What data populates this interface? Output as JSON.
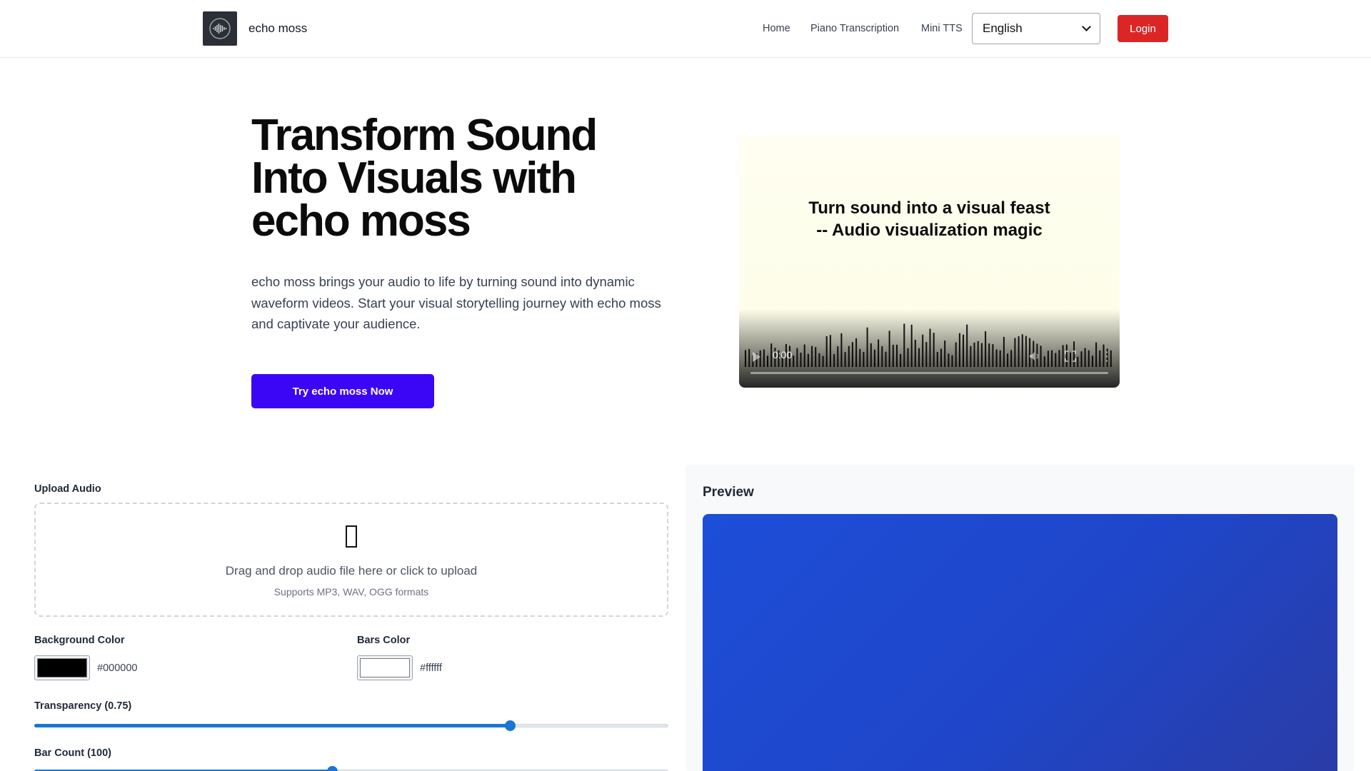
{
  "header": {
    "brand": "echo moss",
    "nav": [
      "Home",
      "Piano Transcription",
      "Mini TTS"
    ],
    "language": "English",
    "login_label": "Login"
  },
  "hero": {
    "title": "Transform Sound Into Visuals with echo moss",
    "description": "echo moss brings your audio to life by turning sound into dynamic waveform videos. Start your visual storytelling journey with echo moss and captivate your audience.",
    "cta_label": "Try echo moss Now"
  },
  "video": {
    "caption_line1": "Turn sound into a visual feast",
    "caption_line2": "-- Audio visualization magic",
    "time": "0:00"
  },
  "upload": {
    "label": "Upload Audio",
    "icon": "file-icon",
    "drop_text": "Drag and drop audio file here or click to upload",
    "formats_text": "Supports MP3, WAV, OGG formats"
  },
  "settings": {
    "background_color_label": "Background Color",
    "background_color_value": "#000000",
    "bars_color_label": "Bars Color",
    "bars_color_value": "#ffffff",
    "transparency_label": "Transparency (0.75)",
    "transparency_value": 0.75,
    "bar_count_label": "Bar Count (100)",
    "bar_count_fraction": 0.47
  },
  "preview": {
    "title": "Preview"
  },
  "colors": {
    "login": "#dc2626",
    "cta": "#3b06f5",
    "slider": "#1976d2",
    "preview_gradient_start": "#1d4ed8",
    "preview_gradient_end": "#2a3ca6"
  }
}
